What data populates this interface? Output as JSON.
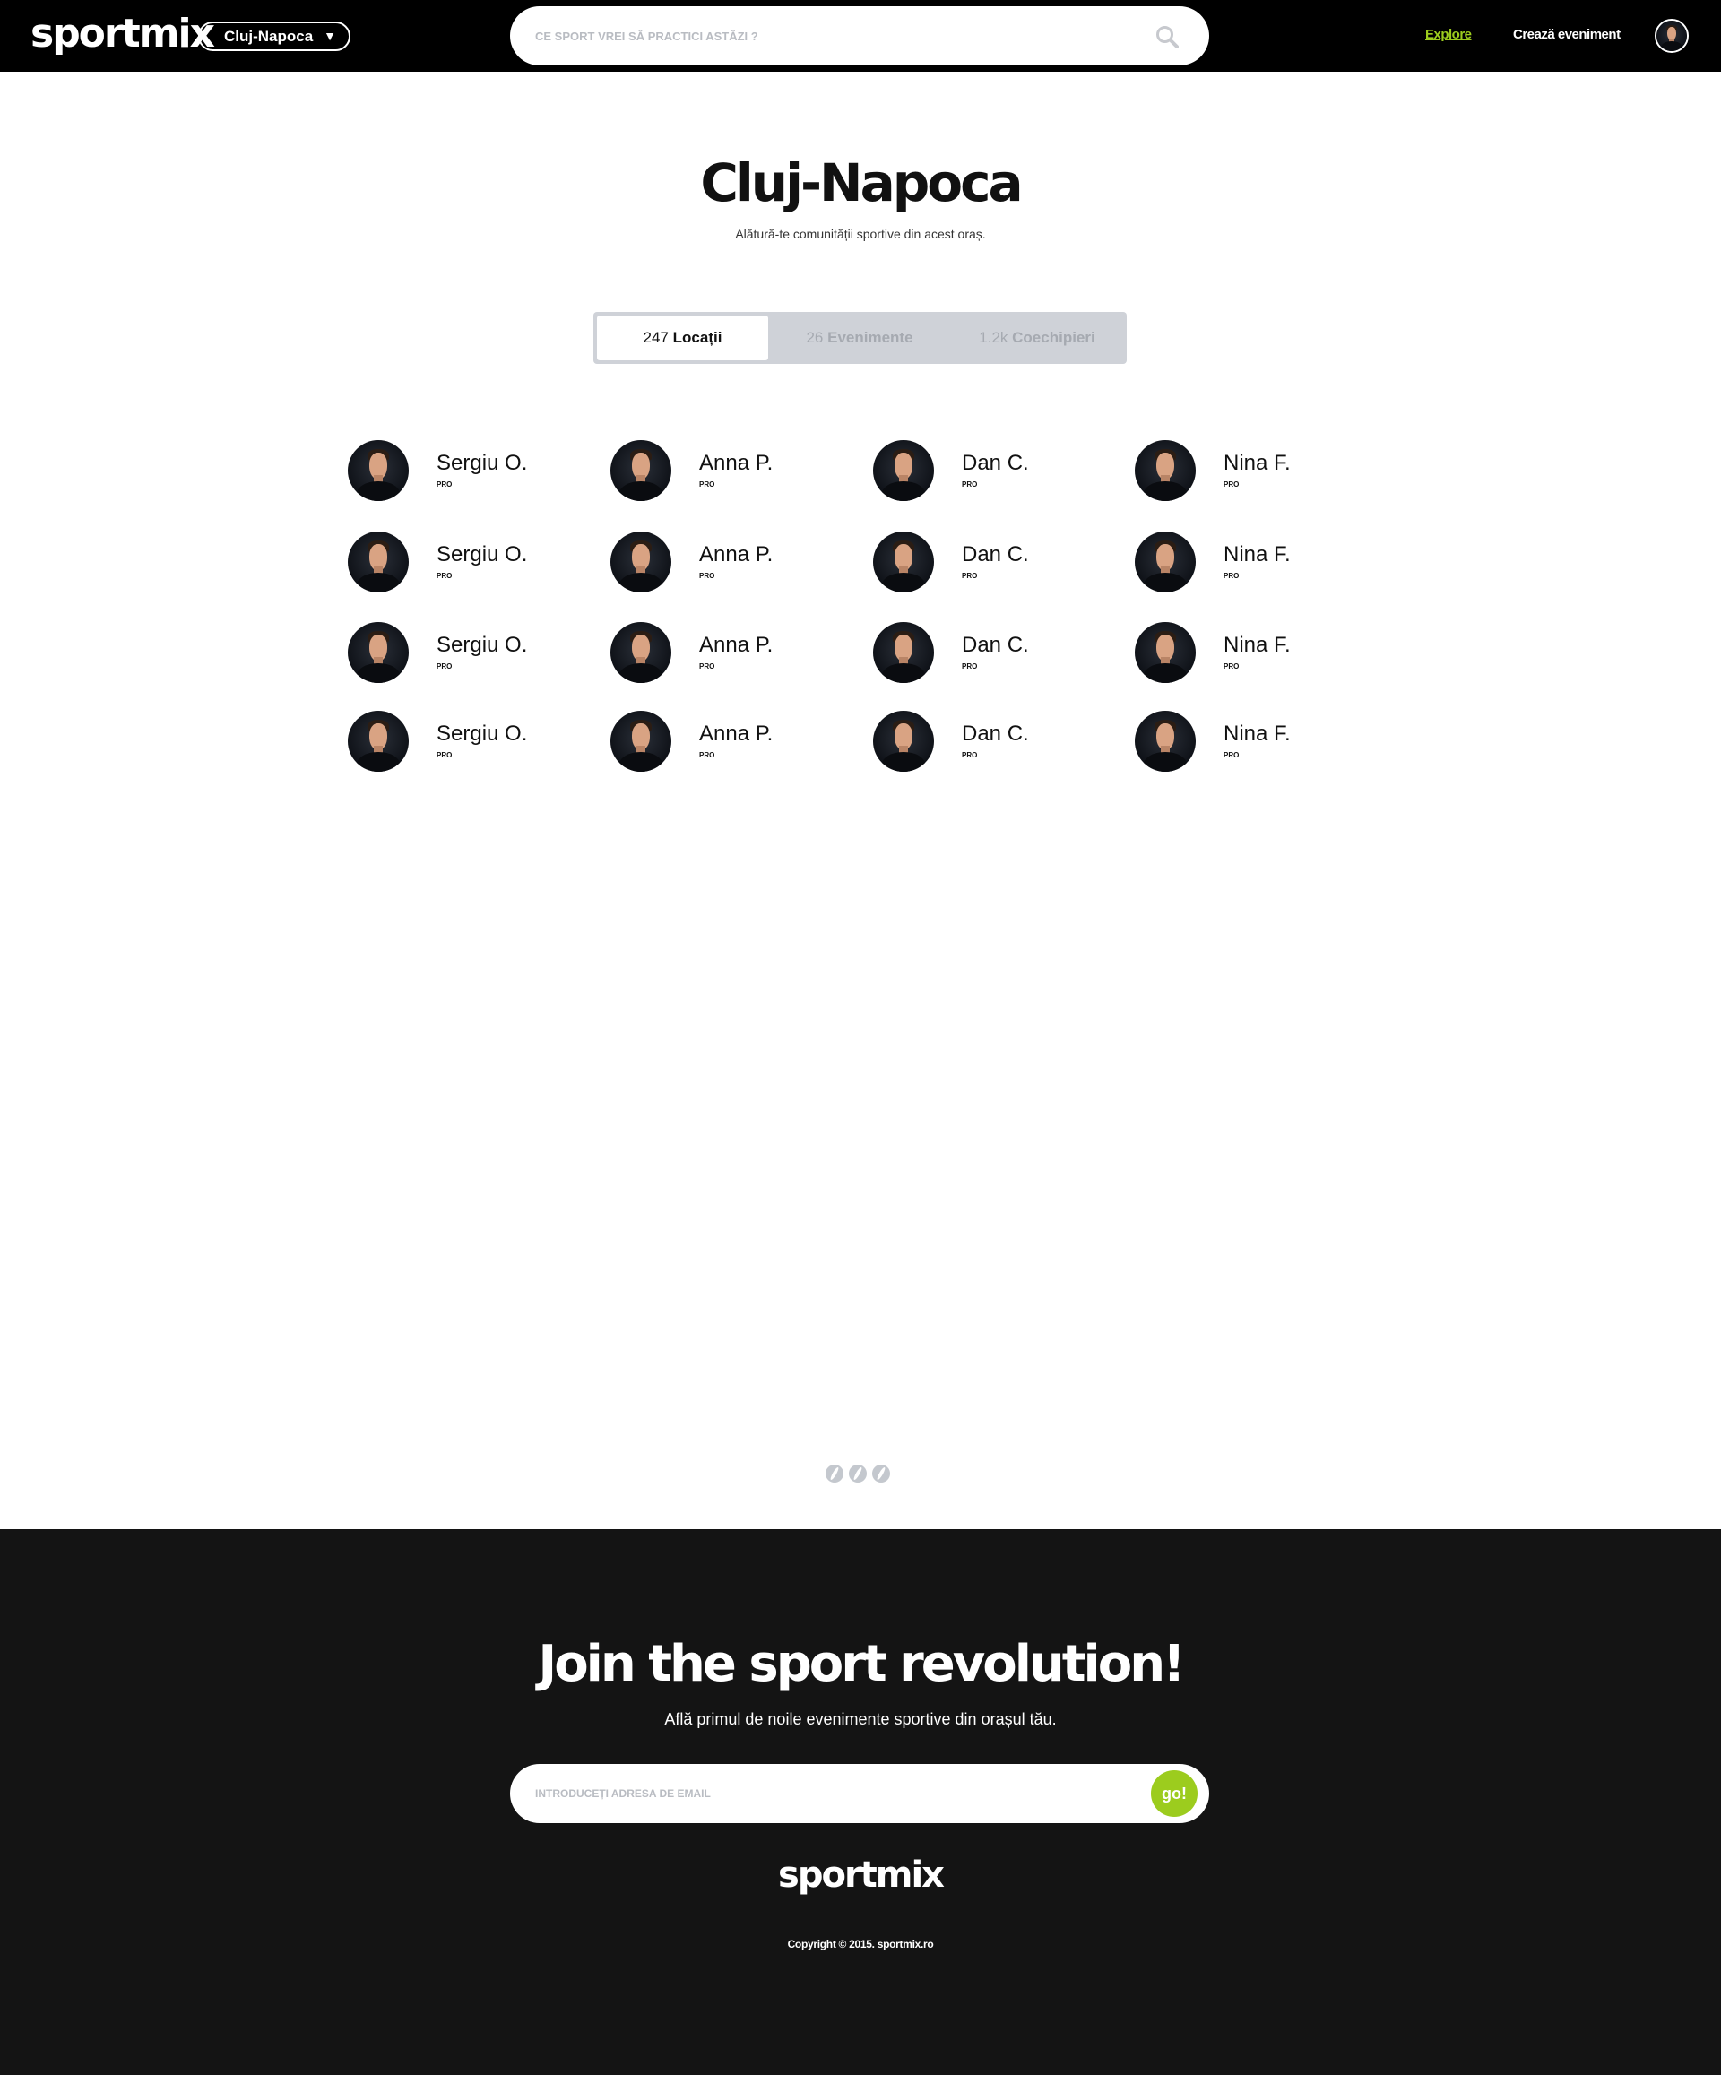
{
  "header": {
    "logo": "sportmix",
    "city": "Cluj-Napoca",
    "search_placeholder": "CE SPORT VREI SĂ PRACTICI ASTĂZI ?",
    "nav": {
      "explore": "Explore",
      "create_event": "Crează eveniment"
    }
  },
  "main": {
    "title": "Cluj-Napoca",
    "subtitle": "Alătură-te comunității sportive din acest oraș.",
    "tabs": [
      {
        "count": "247",
        "label": "Locații",
        "active": true
      },
      {
        "count": "26",
        "label": "Evenimente",
        "active": false
      },
      {
        "count": "1.2k",
        "label": "Coechipieri",
        "active": false
      }
    ],
    "people": [
      {
        "name": "Sergiu O.",
        "tag": "PRO"
      },
      {
        "name": "Anna P.",
        "tag": "PRO"
      },
      {
        "name": "Dan C.",
        "tag": "PRO"
      },
      {
        "name": "Nina F.",
        "tag": "PRO"
      },
      {
        "name": "Sergiu O.",
        "tag": "PRO"
      },
      {
        "name": "Anna P.",
        "tag": "PRO"
      },
      {
        "name": "Dan C.",
        "tag": "PRO"
      },
      {
        "name": "Nina F.",
        "tag": "PRO"
      },
      {
        "name": "Sergiu O.",
        "tag": "PRO"
      },
      {
        "name": "Anna P.",
        "tag": "PRO"
      },
      {
        "name": "Dan C.",
        "tag": "PRO"
      },
      {
        "name": "Nina F.",
        "tag": "PRO"
      },
      {
        "name": "Sergiu O.",
        "tag": "PRO"
      },
      {
        "name": "Anna P.",
        "tag": "PRO"
      },
      {
        "name": "Dan C.",
        "tag": "PRO"
      },
      {
        "name": "Nina F.",
        "tag": "PRO"
      }
    ]
  },
  "footer": {
    "title": "Join the sport revolution!",
    "subtitle": "Află primul de noile evenimente sportive din orașul tău.",
    "email_placeholder": "INTRODUCEȚI ADRESA DE EMAIL",
    "go_label": "go!",
    "logo": "sportmix",
    "copyright": "Copyright © 2015. sportmix.ro"
  },
  "colors": {
    "accent": "#9ccc1e",
    "header_bg": "#000000",
    "footer_bg": "#141414",
    "tabs_bg": "#cfd2d8"
  },
  "icons": {
    "search": "search-icon",
    "dropdown": "chevron-down-icon",
    "loader": "ball-icon"
  }
}
